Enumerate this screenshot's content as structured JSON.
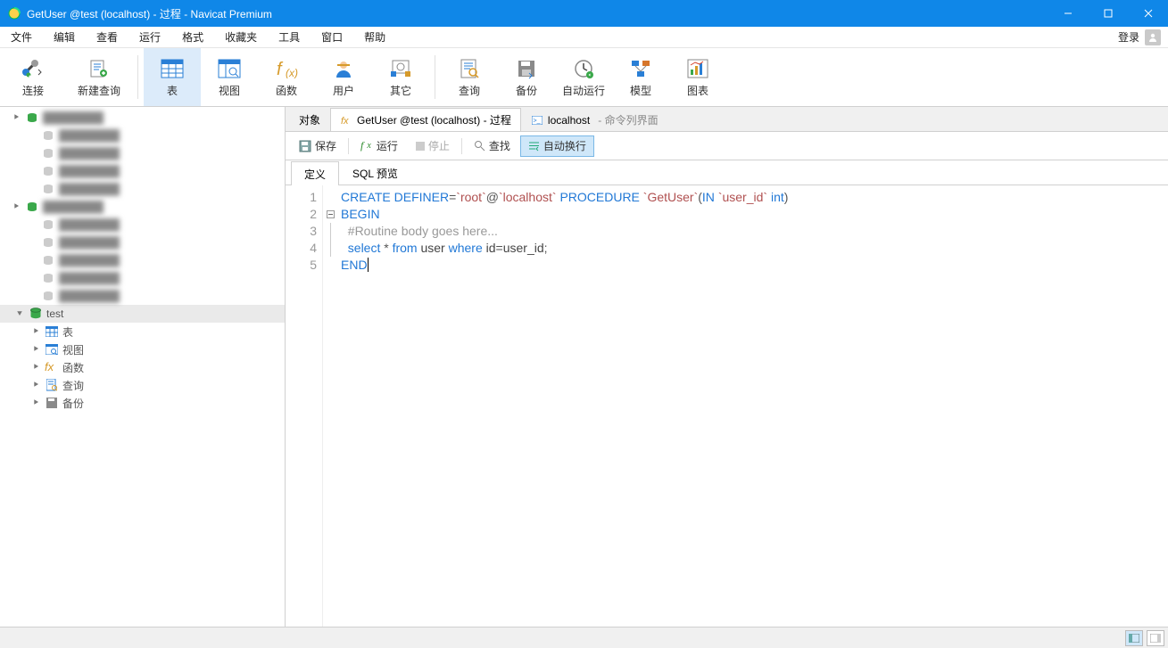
{
  "title": "GetUser @test (localhost) - 过程 - Navicat Premium",
  "menu": {
    "items": [
      "文件",
      "编辑",
      "查看",
      "运行",
      "格式",
      "收藏夹",
      "工具",
      "窗口",
      "帮助"
    ],
    "login": "登录"
  },
  "ribbon": {
    "items": [
      {
        "key": "connect",
        "label": "连接"
      },
      {
        "key": "new-query",
        "label": "新建查询"
      },
      {
        "key": "table",
        "label": "表"
      },
      {
        "key": "view",
        "label": "视图"
      },
      {
        "key": "function",
        "label": "函数"
      },
      {
        "key": "user",
        "label": "用户"
      },
      {
        "key": "other",
        "label": "其它"
      },
      {
        "key": "query",
        "label": "查询"
      },
      {
        "key": "backup",
        "label": "备份"
      },
      {
        "key": "auto-run",
        "label": "自动运行"
      },
      {
        "key": "model",
        "label": "模型"
      },
      {
        "key": "chart",
        "label": "图表"
      }
    ],
    "active": "table"
  },
  "sidebar": {
    "blurred_rows": 11,
    "active_db": "test",
    "children": [
      {
        "key": "tables",
        "label": "表",
        "icon": "table"
      },
      {
        "key": "views",
        "label": "视图",
        "icon": "view"
      },
      {
        "key": "functions",
        "label": "函数",
        "icon": "fx"
      },
      {
        "key": "queries",
        "label": "查询",
        "icon": "query"
      },
      {
        "key": "backups",
        "label": "备份",
        "icon": "backup"
      }
    ]
  },
  "tabs": {
    "items": [
      {
        "key": "objects",
        "label": "对象",
        "icon": "",
        "sub": ""
      },
      {
        "key": "proc",
        "label": "GetUser @test (localhost) - 过程",
        "icon": "fx",
        "sub": ""
      },
      {
        "key": "cmd",
        "label": "localhost",
        "icon": "cmd",
        "sub": " - 命令列界面"
      }
    ],
    "active": "proc"
  },
  "toolbar": {
    "save": "保存",
    "run": "运行",
    "stop": "停止",
    "find": "查找",
    "wrap": "自动换行"
  },
  "subtabs": {
    "items": [
      "定义",
      "SQL 预览"
    ],
    "active": "定义"
  },
  "code": {
    "lines": [
      {
        "n": 1,
        "fold": "",
        "tokens": [
          [
            "kw",
            "CREATE"
          ],
          [
            "sp",
            " "
          ],
          [
            "kw",
            "DEFINER"
          ],
          [
            "op",
            "="
          ],
          [
            "str",
            "`root`"
          ],
          [
            "op",
            "@"
          ],
          [
            "str",
            "`localhost`"
          ],
          [
            "sp",
            " "
          ],
          [
            "kw",
            "PROCEDURE"
          ],
          [
            "sp",
            " "
          ],
          [
            "str",
            "`GetUser`"
          ],
          [
            "op",
            "("
          ],
          [
            "kw",
            "IN"
          ],
          [
            "sp",
            " "
          ],
          [
            "str",
            "`user_id`"
          ],
          [
            "sp",
            " "
          ],
          [
            "kw",
            "int"
          ],
          [
            "op",
            ")"
          ]
        ]
      },
      {
        "n": 2,
        "fold": "-",
        "tokens": [
          [
            "kw",
            "BEGIN"
          ]
        ]
      },
      {
        "n": 3,
        "fold": "|",
        "tokens": [
          [
            "sp",
            "  "
          ],
          [
            "cm",
            "#Routine body goes here..."
          ]
        ]
      },
      {
        "n": 4,
        "fold": "|",
        "tokens": [
          [
            "sp",
            "  "
          ],
          [
            "kw",
            "select"
          ],
          [
            "sp",
            " "
          ],
          [
            "op",
            "*"
          ],
          [
            "sp",
            " "
          ],
          [
            "kw",
            "from"
          ],
          [
            "sp",
            " "
          ],
          [
            "id",
            "user"
          ],
          [
            "sp",
            " "
          ],
          [
            "kw",
            "where"
          ],
          [
            "sp",
            " "
          ],
          [
            "id",
            "id"
          ],
          [
            "op",
            "="
          ],
          [
            "id",
            "user_id"
          ],
          [
            "op",
            ";"
          ]
        ]
      },
      {
        "n": 5,
        "fold": "",
        "tokens": [
          [
            "kw",
            "END"
          ]
        ],
        "cursor": true
      }
    ]
  }
}
